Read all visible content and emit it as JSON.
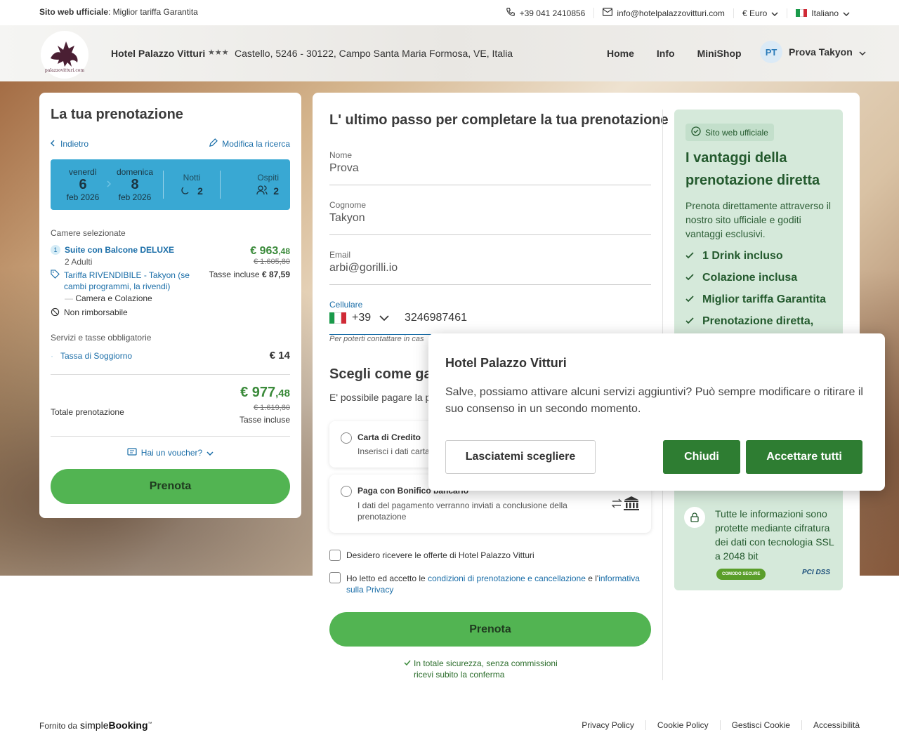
{
  "topbar": {
    "official_bold": "Sito web ufficiale",
    "official_rest": ": Miglior tariffa Garantita",
    "phone": "+39 041 2410856",
    "email": "info@hotelpalazzovitturi.com",
    "currency": "€ Euro",
    "language": "Italiano"
  },
  "header": {
    "logo_text": "palazzovitturi.com",
    "hotel_name": "Hotel Palazzo Vitturi",
    "stars": "★★★",
    "address": "Castello, 5246 - 30122, Campo Santa Maria Formosa, VE, Italia",
    "nav": [
      "Home",
      "Info",
      "MiniShop"
    ],
    "user_initials": "PT",
    "user_name": "Prova Takyon"
  },
  "booking": {
    "title": "La tua prenotazione",
    "back": "Indietro",
    "modify": "Modifica la ricerca",
    "checkin": {
      "weekday": "venerdì",
      "day": "6",
      "month": "feb 2026"
    },
    "checkout": {
      "weekday": "domenica",
      "day": "8",
      "month": "feb 2026"
    },
    "nights_label": "Notti",
    "nights": "2",
    "guests_label": "Ospiti",
    "guests": "2",
    "rooms_title": "Camere selezionate",
    "room_index": "1",
    "room_name": "Suite con Balcone DELUXE",
    "room_adults": "2 Adulti",
    "room_price_int": "€ 963",
    "room_price_dec": ",48",
    "room_price_old": "€ 1.605,80",
    "rate_name": "Tariffa RIVENDIBILE - Takyon (se cambi programmi, la rivendi)",
    "taxes_label": "Tasse incluse",
    "taxes_value": "€ 87,59",
    "board": "Camera e Colazione",
    "refund": "Non rimborsabile",
    "services_title": "Servizi e tasse obbligatorie",
    "tax_name": "Tassa di Soggiorno",
    "tax_value": "€ 14",
    "total_label": "Totale prenotazione",
    "total_int": "€ 977",
    "total_dec": ",48",
    "total_old": "€ 1.619,80",
    "total_taxes": "Tasse incluse",
    "voucher": "Hai un voucher?",
    "book_btn": "Prenota"
  },
  "form": {
    "title": "L' ultimo passo per completare la tua prenotazione",
    "name_label": "Nome",
    "name_value": "Prova",
    "surname_label": "Cognome",
    "surname_value": "Takyon",
    "email_label": "Email",
    "email_value": "arbi@gorilli.io",
    "phone_label": "Cellulare",
    "phone_prefix": "+39",
    "phone_value": "3246987461",
    "phone_hint": "Per poterti contattare in cas",
    "pay_title": "Scegli come gar",
    "pay_sub": "E' possibile pagare la p",
    "card_title": "Carta di Credito",
    "card_sub": "Inserisci i dati carta",
    "bank_title": "Paga con Bonifico bancario",
    "bank_sub": "I dati del pagamento verranno inviati a conclusione della prenotazione",
    "offers_check": "Desidero ricevere le offerte di Hotel Palazzo Vitturi",
    "terms_a": "Ho letto ed accetto le ",
    "terms_link1": "condizioni di prenotazione e cancellazione",
    "terms_b": " e l'",
    "terms_link2": "informativa sulla Privacy",
    "book_btn": "Prenota",
    "secure1": "In totale sicurezza, senza commissioni",
    "secure2": "ricevi subito la conferma"
  },
  "advantages": {
    "badge": "Sito web ufficiale",
    "title": "I vantaggi della prenotazione diretta",
    "text": "Prenota direttamente attraverso il nostro sito ufficiale e goditi vantaggi esclusivi.",
    "items": [
      "1 Drink incluso",
      "Colazione inclusa",
      "Miglior tariffa Garantita",
      "Prenotazione diretta,"
    ],
    "ssl_text": "Tutte le informazioni sono protette mediante cifratura dei dati con tecnologia SSL a 2048 bit",
    "comodo": "COMODO SECURE",
    "pci": "PCI DSS"
  },
  "dialog": {
    "title": "Hotel Palazzo Vitturi",
    "text": "Salve, possiamo attivare alcuni servizi aggiuntivi? Può sempre modificare o ritirare il suo consenso in un secondo momento.",
    "choose": "Lasciatemi scegliere",
    "close": "Chiudi",
    "accept": "Accettare tutti"
  },
  "footer": {
    "powered": "Fornito da",
    "brand_a": "simple",
    "brand_b": "Booking",
    "links": [
      "Privacy Policy",
      "Cookie Policy",
      "Gestisci Cookie",
      "Accessibilità"
    ]
  },
  "colors": {
    "accent_green": "#52b452",
    "dark_green": "#2e7d32",
    "blue_box": "#39a8d3"
  }
}
